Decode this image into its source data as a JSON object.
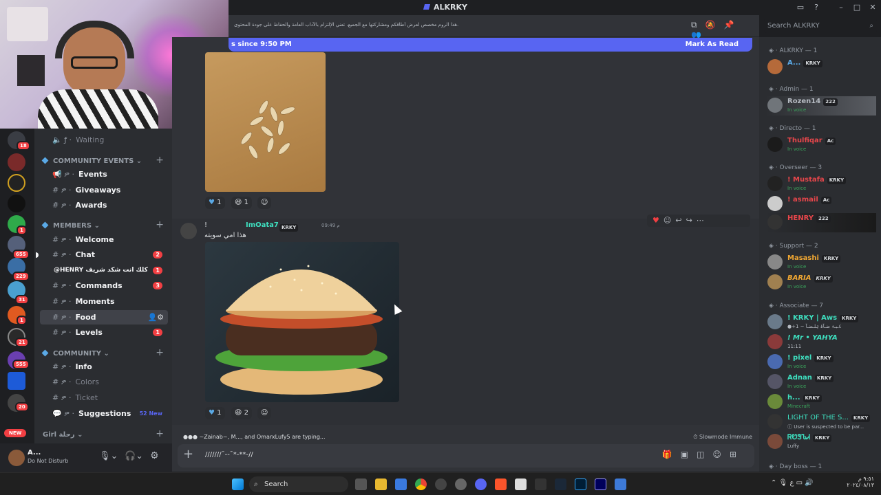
{
  "app": {
    "title": "ALKRKY"
  },
  "topbar": {
    "topic": "هذا الروم مخصص لعرض أطاقكم ومشاركتها مع الجميع. تعني الإلتزام بالآداب العامة والحفاظ على جودة المحتوى."
  },
  "search": {
    "placeholder": "Search ALKRKY"
  },
  "new_messages": {
    "since": "s since 9:50 PM",
    "mark_read": "Mark As Read"
  },
  "channels": {
    "waiting": "Waiting",
    "categories": [
      {
        "label": "COMMUNITY EVENTS"
      },
      {
        "label": "MEMBERS"
      },
      {
        "label": "COMMUNITY"
      },
      {
        "label": "Girl رحلة"
      }
    ],
    "items": [
      {
        "label": "Events"
      },
      {
        "label": "Giveaways"
      },
      {
        "label": "Awards"
      },
      {
        "label": "Welcome"
      },
      {
        "label": "Chat",
        "count": "2"
      },
      {
        "label": "@HENRY كلك انت شكد شريف",
        "count": "1"
      },
      {
        "label": "Commands",
        "count": "3"
      },
      {
        "label": "Moments"
      },
      {
        "label": "Food"
      },
      {
        "label": "Levels",
        "count": "1"
      },
      {
        "label": "Info"
      },
      {
        "label": "Colors"
      },
      {
        "label": "Ticket"
      },
      {
        "label": "Suggestions",
        "new": "52 New"
      }
    ]
  },
  "rail": {
    "badges": [
      "18",
      "1",
      "655",
      "229",
      "31",
      "1",
      "21",
      "555",
      "20"
    ],
    "new_label": "NEW"
  },
  "user_panel": {
    "name": "A...",
    "status": "Do Not Disturb"
  },
  "messages": {
    "first": {
      "reactions": [
        "1",
        "1"
      ]
    },
    "second": {
      "author": "ImOata7",
      "prefix": "!",
      "tag": "KRKY",
      "time": "09:49 م",
      "text": "هذا امي سويته",
      "reactions": [
        "1",
        "2"
      ]
    }
  },
  "typing": {
    "text": "~Zainab~, M..., and OmarxLufy5 are typing...",
    "slowmode": "Slowmode Immune"
  },
  "composer": {
    "value": "///////¯--¯*-**-//"
  },
  "members": {
    "groups": [
      {
        "label": "ALKRKY — 1"
      },
      {
        "label": "Admin — 1"
      },
      {
        "label": "Directo — 1"
      },
      {
        "label": "Overseer — 3"
      },
      {
        "label": "Support — 2"
      },
      {
        "label": "Associate — 7"
      },
      {
        "label": "Day boss — 1"
      }
    ],
    "list": [
      {
        "name": "A...",
        "tag": "KRKY",
        "sub": "",
        "color": "#5aa9e6"
      },
      {
        "name": "Rozen14",
        "tag": "222",
        "sub": "In voice",
        "color": "#9aa0a6"
      },
      {
        "name": "Thulfiqar",
        "tag": "Ac",
        "sub": "In voice",
        "color": "#e8464b"
      },
      {
        "name": "! Mustafa",
        "tag": "KRKY",
        "sub": "In voice",
        "color": "#e8464b"
      },
      {
        "name": "! asmail",
        "tag": "Ac",
        "sub": "",
        "color": "#e8464b"
      },
      {
        "name": "HENRY",
        "tag": "222",
        "sub": "",
        "color": "#e8464b"
      },
      {
        "name": "Masashi",
        "tag": "KRKY",
        "sub": "In voice",
        "color": "#f0a732"
      },
      {
        "name": "BARIA",
        "tag": "KRKY",
        "sub": "In voice",
        "color": "#f0a732"
      },
      {
        "name": "! KRKY | Aws",
        "tag": "KRKY",
        "sub": "●+1 ~ ٤ـبـۂ ضـآۂ ۂلـضـآ",
        "color": "#3ee0c0"
      },
      {
        "name": "! Mr • YAHYA",
        "tag": "",
        "sub": "11:11",
        "color": "#3ee0c0"
      },
      {
        "name": "! pixel",
        "tag": "KRKY",
        "sub": "In voice",
        "color": "#3ee0c0"
      },
      {
        "name": "Adnan",
        "tag": "KRKY",
        "sub": "In voice",
        "color": "#3ee0c0"
      },
      {
        "name": "h...",
        "tag": "KRKY",
        "sub": "Minecraft",
        "color": "#3ee0c0"
      },
      {
        "name": "LIGHT OF THE S...",
        "tag": "KRKY",
        "sub": "ⓘ User is suspected to be par...",
        "color": "#3ee0c0"
      },
      {
        "name": "ᏒᏬᏕᏖᏗ",
        "tag": "KRKY",
        "sub": "Luffy",
        "color": "#3ee0c0"
      }
    ]
  },
  "taskbar": {
    "search": "Search",
    "time": "٩:٥١ م",
    "date": "٢٠٢٤/٠٨/١٣"
  }
}
